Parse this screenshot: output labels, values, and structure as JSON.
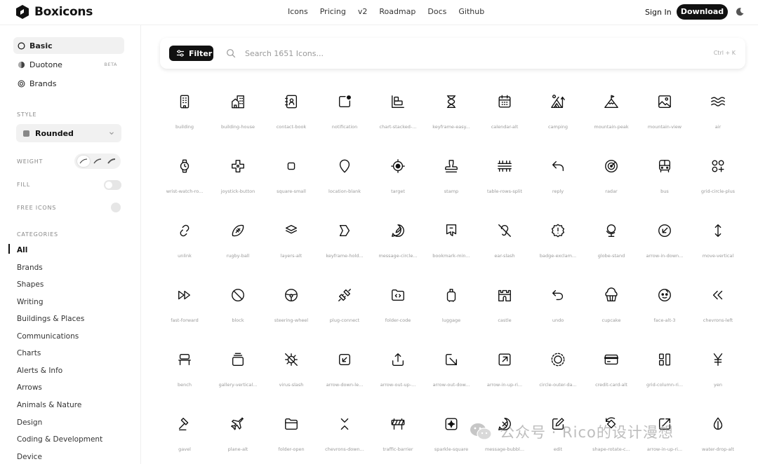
{
  "brand": {
    "name": "Boxicons"
  },
  "nav": {
    "links": [
      "Icons",
      "Pricing",
      "v2",
      "Roadmap",
      "Docs",
      "Github"
    ],
    "signin": "Sign In",
    "download": "Download"
  },
  "sidebar": {
    "variants": [
      {
        "label": "Basic",
        "icon": "circle-icon",
        "active": true
      },
      {
        "label": "Duotone",
        "icon": "duotone-icon",
        "badge": "BETA"
      },
      {
        "label": "Brands",
        "icon": "brands-icon"
      }
    ],
    "style_label": "STYLE",
    "style_value": "Rounded",
    "weight_label": "WEIGHT",
    "fill_label": "FILL",
    "free_label": "FREE ICONS",
    "categories_label": "CATEGORIES",
    "categories": [
      "All",
      "Brands",
      "Shapes",
      "Writing",
      "Buildings & Places",
      "Communications",
      "Charts",
      "Alerts & Info",
      "Arrows",
      "Animals & Nature",
      "Design",
      "Coding & Development",
      "Device"
    ]
  },
  "search": {
    "filter_label": "Filter",
    "placeholder": "Search 1651 Icons...",
    "shortcut": "Ctrl + K"
  },
  "icons": [
    "building",
    "building-house",
    "contact-book",
    "notification",
    "chart-stacked-...",
    "keyframe-easy...",
    "calendar-alt",
    "camping",
    "mountain-peak",
    "mountain-view",
    "air",
    "wrist-watch-ro...",
    "joystick-button",
    "square-small",
    "location-blank",
    "target",
    "stamp",
    "table-rows-split",
    "reply",
    "radar",
    "bus",
    "grid-circle-plus",
    "unlink",
    "rugby-ball",
    "layers-alt",
    "keyframe-hold...",
    "message-circle...",
    "bookmark-min...",
    "ear-slash",
    "badge-exclam...",
    "globe-stand",
    "arrow-in-down...",
    "move-vertical",
    "fast-forward",
    "block",
    "steering-wheel",
    "plug-connect",
    "folder-code",
    "luggage",
    "castle",
    "undo",
    "cupcake",
    "face-alt-3",
    "chevrons-left",
    "bench",
    "gallery-vertical...",
    "virus-slash",
    "arrow-down-le...",
    "arrow-out-up-...",
    "arrow-out-dow...",
    "arrow-in-up-ri...",
    "circle-outer-da...",
    "credit-card-alt",
    "grid-column-ri...",
    "yen",
    "gavel",
    "plane-alt",
    "folder-open",
    "chevrons-down...",
    "traffic-barrier",
    "sparkle-square",
    "message-bubbl...",
    "edit",
    "shape-rotate-c...",
    "arrow-in-up-ri...",
    "water-drop-alt"
  ],
  "watermark": {
    "text": "公众号 · Rico的设计漫想"
  }
}
